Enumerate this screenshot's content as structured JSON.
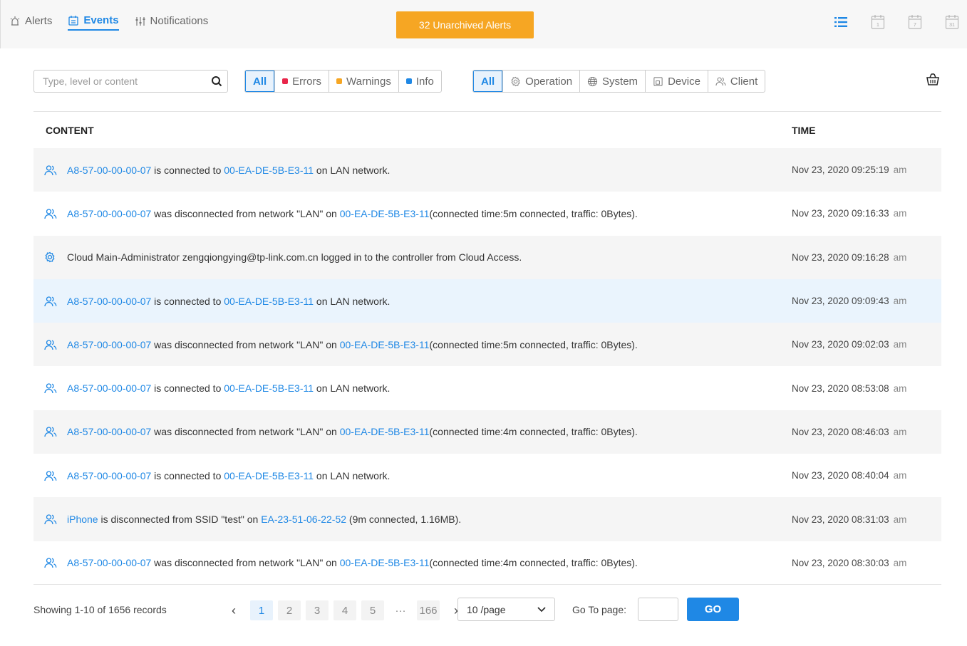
{
  "tabs": [
    {
      "label": "Alerts"
    },
    {
      "label": "Events"
    },
    {
      "label": "Notifications"
    }
  ],
  "unarchived_button": "32 Unarchived Alerts",
  "search": {
    "placeholder": "Type, level or content"
  },
  "level_filter": {
    "all": "All",
    "errors": "Errors",
    "warnings": "Warnings",
    "info": "Info"
  },
  "type_filter": {
    "all": "All",
    "operation": "Operation",
    "system": "System",
    "device": "Device",
    "client": "Client"
  },
  "columns": {
    "content": "CONTENT",
    "time": "TIME"
  },
  "rows": [
    {
      "icon": "client-icon",
      "p": [
        {
          "l": "A8-57-00-00-00-07"
        },
        {
          "t": " is connected to "
        },
        {
          "l": "00-EA-DE-5B-E3-11"
        },
        {
          "t": " on LAN network."
        }
      ],
      "time": "Nov 23, 2020 09:25:19",
      "ampm": "am"
    },
    {
      "icon": "client-icon",
      "p": [
        {
          "l": "A8-57-00-00-00-07"
        },
        {
          "t": " was disconnected from network \"LAN\" on "
        },
        {
          "l": "00-EA-DE-5B-E3-11"
        },
        {
          "t": "(connected time:5m connected, traffic: 0Bytes)."
        }
      ],
      "time": "Nov 23, 2020 09:16:33",
      "ampm": "am"
    },
    {
      "icon": "operation-icon",
      "p": [
        {
          "t": "Cloud Main-Administrator zengqiongying@tp-link.com.cn logged in to the controller from Cloud Access."
        }
      ],
      "time": "Nov 23, 2020 09:16:28",
      "ampm": "am"
    },
    {
      "icon": "client-icon",
      "p": [
        {
          "l": "A8-57-00-00-00-07"
        },
        {
          "t": " is connected to "
        },
        {
          "l": "00-EA-DE-5B-E3-11"
        },
        {
          "t": " on LAN network."
        }
      ],
      "time": "Nov 23, 2020 09:09:43",
      "ampm": "am"
    },
    {
      "icon": "client-icon",
      "p": [
        {
          "l": "A8-57-00-00-00-07"
        },
        {
          "t": " was disconnected from network \"LAN\" on "
        },
        {
          "l": "00-EA-DE-5B-E3-11"
        },
        {
          "t": "(connected time:5m connected, traffic: 0Bytes)."
        }
      ],
      "time": "Nov 23, 2020 09:02:03",
      "ampm": "am"
    },
    {
      "icon": "client-icon",
      "p": [
        {
          "l": "A8-57-00-00-00-07"
        },
        {
          "t": " is connected to "
        },
        {
          "l": "00-EA-DE-5B-E3-11"
        },
        {
          "t": " on LAN network."
        }
      ],
      "time": "Nov 23, 2020 08:53:08",
      "ampm": "am"
    },
    {
      "icon": "client-icon",
      "p": [
        {
          "l": "A8-57-00-00-00-07"
        },
        {
          "t": " was disconnected from network \"LAN\" on "
        },
        {
          "l": "00-EA-DE-5B-E3-11"
        },
        {
          "t": "(connected time:4m connected, traffic: 0Bytes)."
        }
      ],
      "time": "Nov 23, 2020 08:46:03",
      "ampm": "am"
    },
    {
      "icon": "client-icon",
      "p": [
        {
          "l": "A8-57-00-00-00-07"
        },
        {
          "t": " is connected to "
        },
        {
          "l": "00-EA-DE-5B-E3-11"
        },
        {
          "t": " on LAN network."
        }
      ],
      "time": "Nov 23, 2020 08:40:04",
      "ampm": "am"
    },
    {
      "icon": "client-icon",
      "p": [
        {
          "l": "iPhone"
        },
        {
          "t": " is disconnected from SSID \"test\" on "
        },
        {
          "l": "EA-23-51-06-22-52"
        },
        {
          "t": " (9m connected, 1.16MB)."
        }
      ],
      "time": "Nov 23, 2020 08:31:03",
      "ampm": "am"
    },
    {
      "icon": "client-icon",
      "p": [
        {
          "l": "A8-57-00-00-00-07"
        },
        {
          "t": " was disconnected from network \"LAN\" on "
        },
        {
          "l": "00-EA-DE-5B-E3-11"
        },
        {
          "t": "(connected time:4m connected, traffic: 0Bytes)."
        }
      ],
      "time": "Nov 23, 2020 08:30:03",
      "ampm": "am"
    }
  ],
  "footer": {
    "showing": "Showing 1-10 of 1656 records",
    "pages": [
      "1",
      "2",
      "3",
      "4",
      "5",
      "···",
      "166"
    ],
    "current_page": "1",
    "per_page": "10 /page",
    "goto_label": "Go To page:",
    "goto_value": "",
    "go_button": "GO"
  },
  "colors": {
    "accent": "#1f88e5",
    "orange": "#f6a623",
    "error": "#e8264a",
    "warning": "#f6a623",
    "info": "#1f88e5"
  }
}
